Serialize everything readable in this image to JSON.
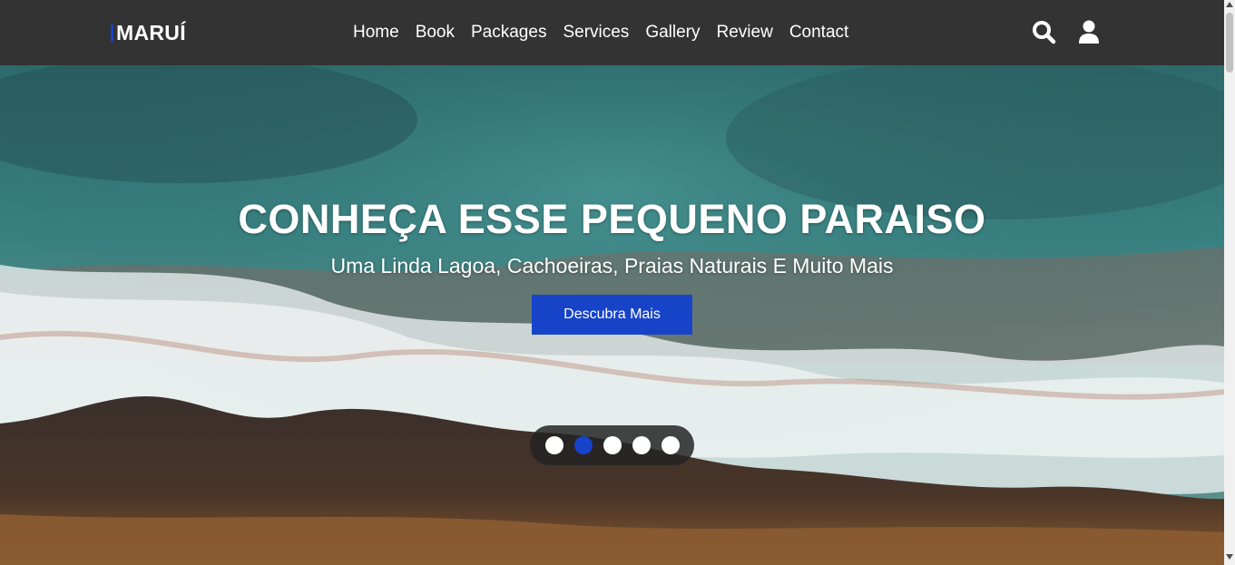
{
  "header": {
    "logo": "MARUÍ",
    "nav": [
      "Home",
      "Book",
      "Packages",
      "Services",
      "Gallery",
      "Review",
      "Contact"
    ],
    "icons": [
      "search-icon",
      "user-icon"
    ]
  },
  "hero": {
    "title": "CONHEÇA ESSE PEQUENO PARAISO",
    "subtitle": "Uma Linda Lagoa, Cachoeiras, Praias Naturais E Muito Mais",
    "button_label": "Descubra Mais",
    "slider_dots": 5,
    "active_dot": 2
  },
  "colors": {
    "header_bg": "#333333",
    "accent": "#1743c9",
    "text": "#ffffff"
  }
}
